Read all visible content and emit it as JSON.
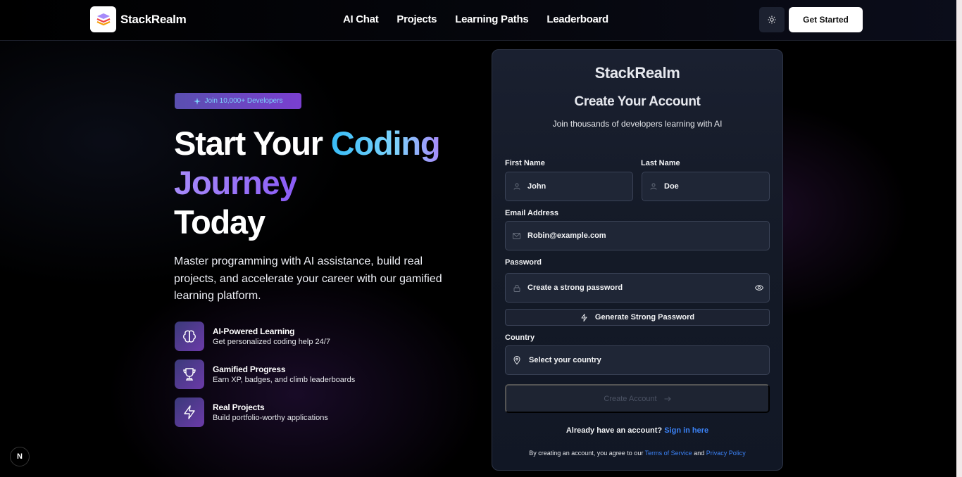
{
  "header": {
    "brand": "StackRealm",
    "nav": [
      "AI Chat",
      "Projects",
      "Learning Paths",
      "Leaderboard"
    ],
    "theme_icon": "sun-icon",
    "cta_label": "Get Started"
  },
  "hero": {
    "badge": "Join 10,000+ Developers",
    "title_line1_a": "Start Your ",
    "title_line1_b": "Coding",
    "title_line2": "Journey",
    "title_line3": "Today",
    "description": "Master programming with AI assistance, build real projects, and accelerate your career with our gamified learning platform.",
    "features": [
      {
        "title": "AI-Powered Learning",
        "subtitle": "Get personalized coding help 24/7",
        "icon": "brain-icon"
      },
      {
        "title": "Gamified Progress",
        "subtitle": "Earn XP, badges, and climb leaderboards",
        "icon": "trophy-icon"
      },
      {
        "title": "Real Projects",
        "subtitle": "Build portfolio-worthy applications",
        "icon": "lightning-icon"
      }
    ]
  },
  "form": {
    "brand": "StackRealm",
    "title": "Create Your Account",
    "subtitle": "Join thousands of developers learning with AI",
    "first_name_label": "First Name",
    "first_name_value": "John",
    "last_name_label": "Last Name",
    "last_name_value": "Doe",
    "email_label": "Email Address",
    "email_value": "Robin@example.com",
    "password_label": "Password",
    "password_placeholder": "Create a strong password",
    "generate_label": "Generate Strong Password",
    "country_label": "Country",
    "country_placeholder": "Select your country",
    "submit_label": "Create Account",
    "signin_text": "Already have an account?",
    "signin_link": "Sign in here",
    "terms_prefix": "By creating an account, you agree to our",
    "terms_link": "Terms of Service",
    "terms_and": "and",
    "privacy_link": "Privacy Policy"
  },
  "misc": {
    "framework_badge": "N"
  }
}
